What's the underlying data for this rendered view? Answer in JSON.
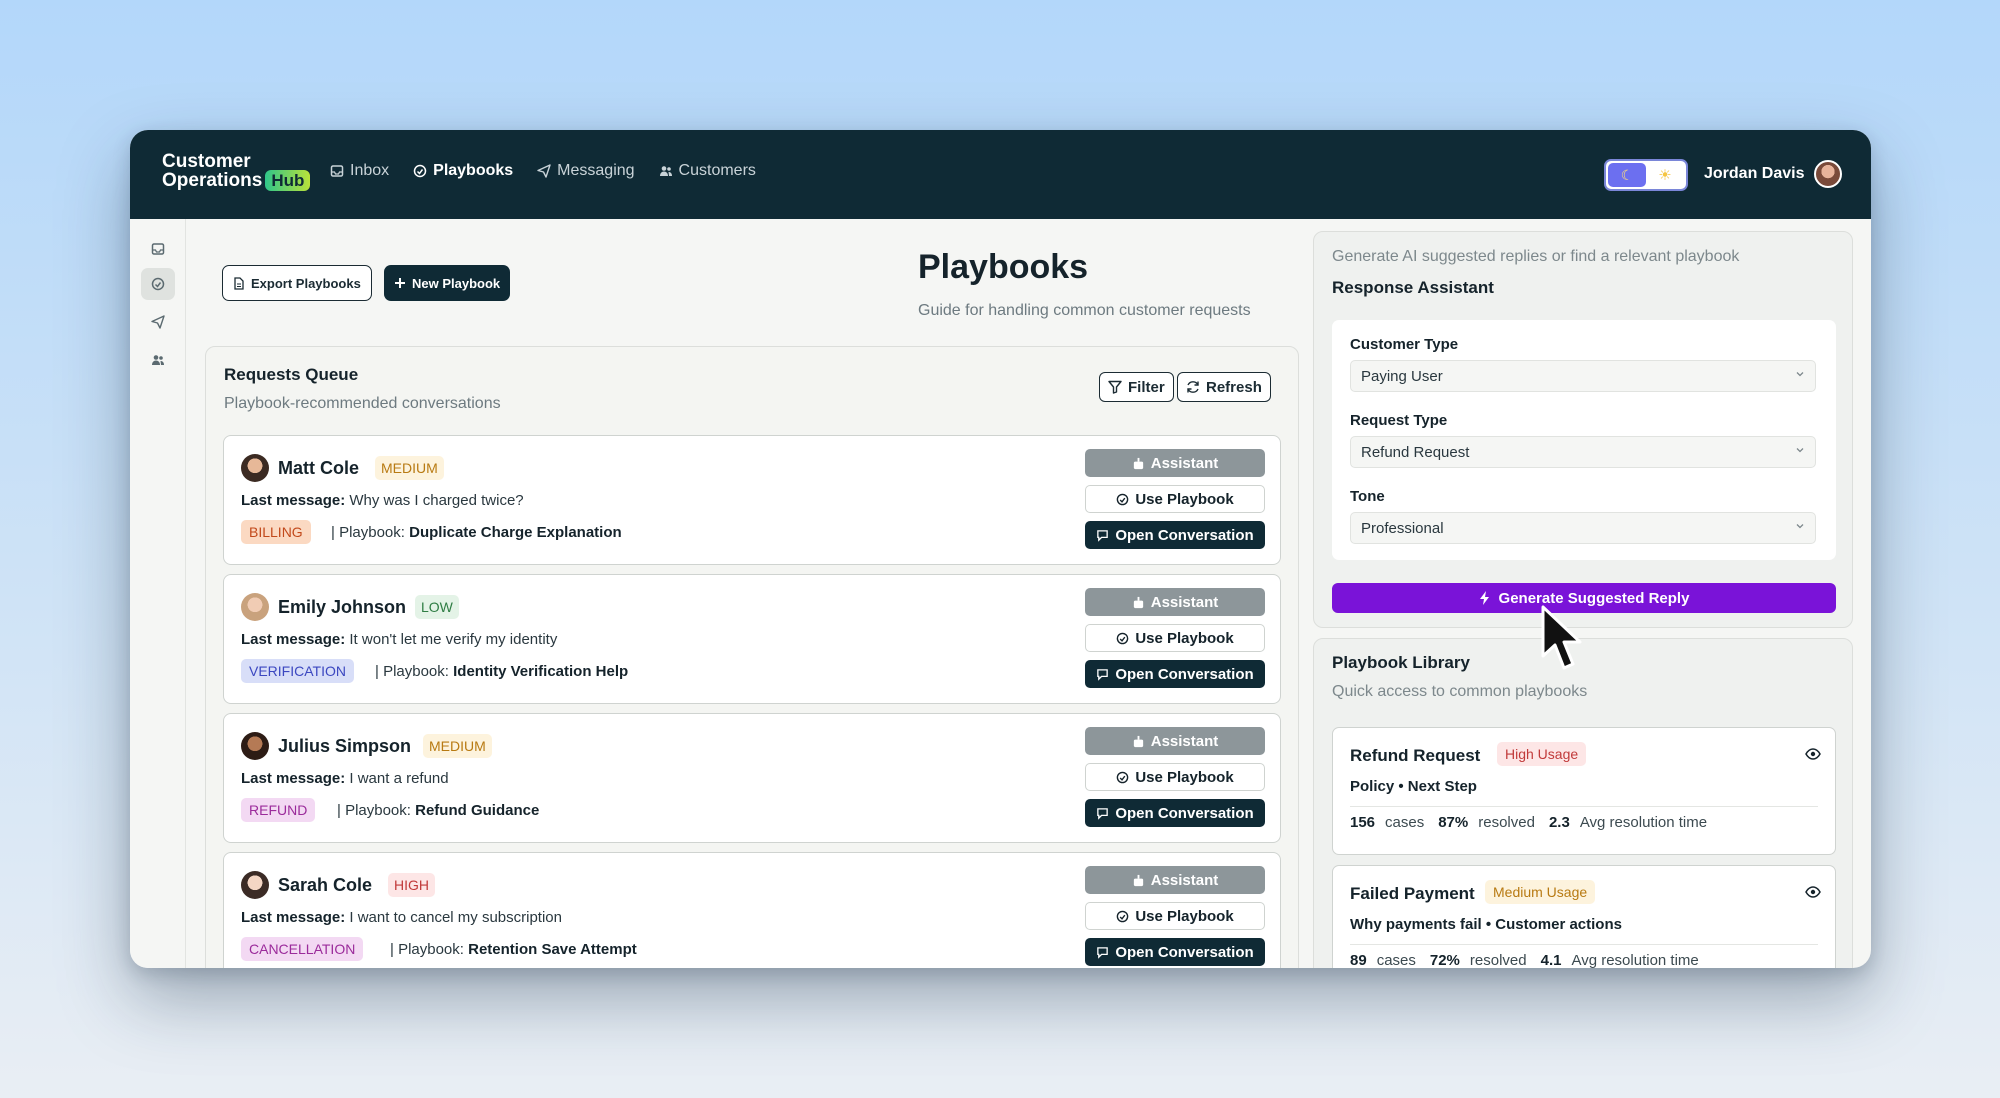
{
  "brand": {
    "line1": "Customer",
    "line2": "Operations",
    "badge": "Hub"
  },
  "nav": [
    {
      "label": "Inbox",
      "icon": "inbox-icon",
      "active": false
    },
    {
      "label": "Playbooks",
      "icon": "playbook-icon",
      "active": true
    },
    {
      "label": "Messaging",
      "icon": "paper-plane-icon",
      "active": false
    },
    {
      "label": "Customers",
      "icon": "users-icon",
      "active": false
    }
  ],
  "theme": {
    "dark_icon": "☾",
    "light_icon": "☀"
  },
  "user": {
    "name": "Jordan Davis"
  },
  "toolbar": {
    "export_label": "Export Playbooks",
    "new_label": "New Playbook"
  },
  "page": {
    "title": "Playbooks",
    "subtitle": "Guide for handling common customer requests"
  },
  "queue": {
    "title": "Requests Queue",
    "subtitle": "Playbook-recommended conversations",
    "filter_label": "Filter",
    "refresh_label": "Refresh",
    "last_message_label": "Last message:",
    "playbook_label": "| Playbook:",
    "assistant_label": "Assistant",
    "use_playbook_label": "Use Playbook",
    "open_label": "Open Conversation",
    "items": [
      {
        "name": "Matt Cole",
        "priority": "MEDIUM",
        "message": "Why was I charged twice?",
        "tag": "BILLING",
        "playbook": "Duplicate Charge Explanation"
      },
      {
        "name": "Emily Johnson",
        "priority": "LOW",
        "message": "It won't let me verify my identity",
        "tag": "VERIFICATION",
        "playbook": "Identity Verification Help"
      },
      {
        "name": "Julius Simpson",
        "priority": "MEDIUM",
        "message": "I want a refund",
        "tag": "REFUND",
        "playbook": "Refund Guidance"
      },
      {
        "name": "Sarah Cole",
        "priority": "HIGH",
        "message": "I want to cancel my subscription",
        "tag": "CANCELLATION",
        "playbook": "Retention Save Attempt"
      }
    ]
  },
  "assistant": {
    "subtitle": "Generate AI suggested replies or find a relevant playbook",
    "title": "Response Assistant",
    "customer_type_label": "Customer Type",
    "customer_type_value": "Paying User",
    "request_type_label": "Request Type",
    "request_type_value": "Refund Request",
    "tone_label": "Tone",
    "tone_value": "Professional",
    "generate_label": "Generate Suggested Reply"
  },
  "library": {
    "title": "Playbook Library",
    "subtitle": "Quick access to common playbooks",
    "cases_label": "cases",
    "resolved_label": "resolved",
    "avg_label": "Avg resolution time",
    "items": [
      {
        "name": "Refund Request",
        "usage": "High Usage",
        "desc": "Policy • Next Step",
        "cases": "156",
        "resolved": "87%",
        "avg": "2.3"
      },
      {
        "name": "Failed Payment",
        "usage": "Medium Usage",
        "desc": "Why payments fail • Customer actions",
        "cases": "89",
        "resolved": "72%",
        "avg": "4.1"
      }
    ]
  }
}
